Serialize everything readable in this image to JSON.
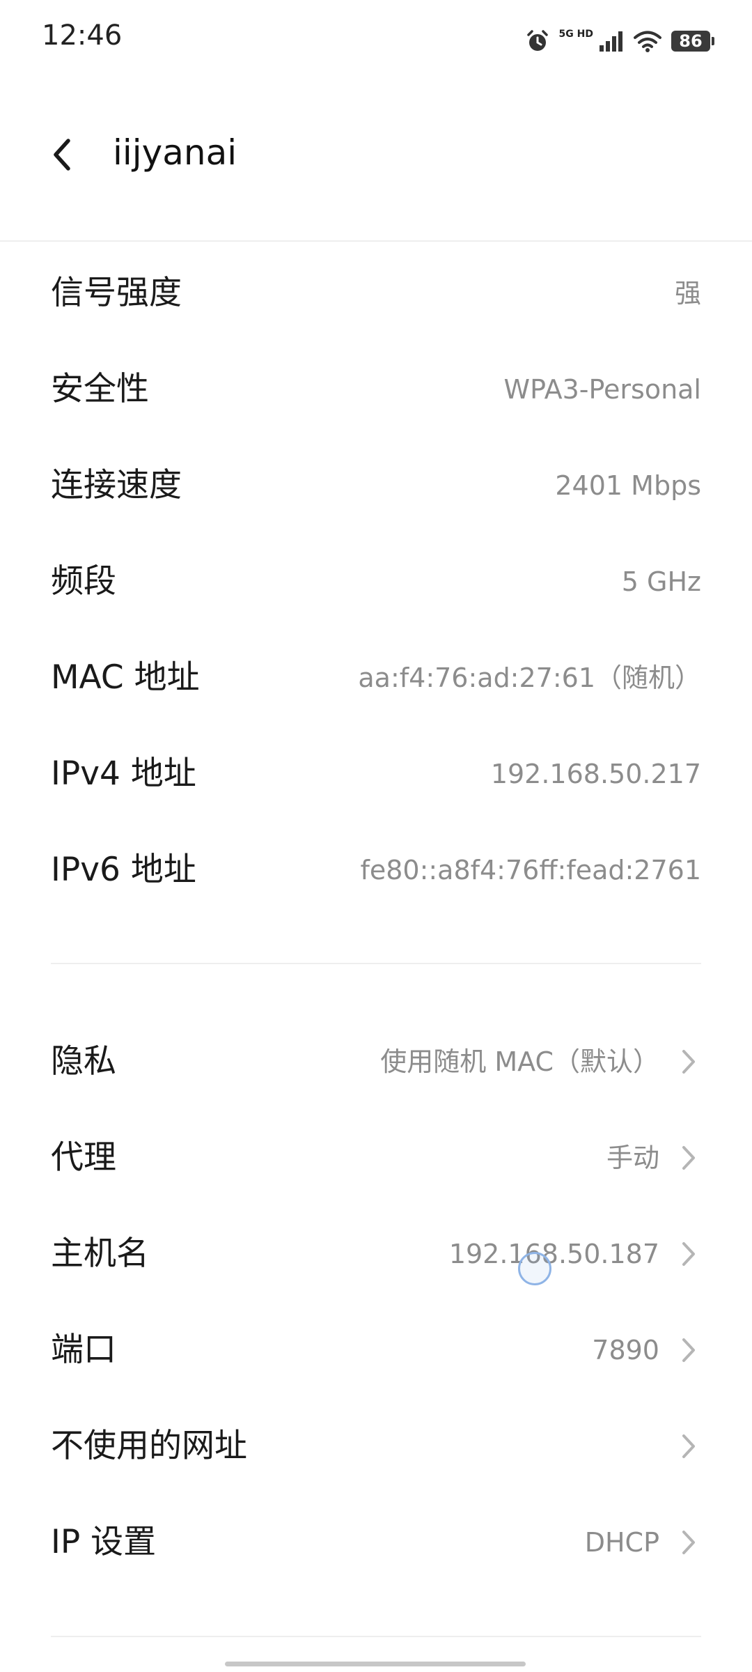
{
  "status_bar": {
    "time": "12:46",
    "network_label": "5G HD",
    "battery": "86",
    "icons": [
      "alarm-icon",
      "signal-icon",
      "wifi-icon",
      "battery-icon"
    ]
  },
  "header": {
    "title": "iijyanai",
    "back_icon": "chevron-left-icon"
  },
  "details": [
    {
      "label": "信号强度",
      "value": "强"
    },
    {
      "label": "安全性",
      "value": "WPA3-Personal"
    },
    {
      "label": "连接速度",
      "value": "2401 Mbps"
    },
    {
      "label": "频段",
      "value": "5 GHz"
    },
    {
      "label": "MAC 地址",
      "value": "aa:f4:76:ad:27:61（随机）"
    },
    {
      "label": "IPv4 地址",
      "value": "192.168.50.217"
    },
    {
      "label": "IPv6 地址",
      "value": "fe80::a8f4:76ff:fead:2761"
    }
  ],
  "settings": [
    {
      "label": "隐私",
      "value": "使用随机 MAC（默认）"
    },
    {
      "label": "代理",
      "value": "手动"
    },
    {
      "label": "主机名",
      "value": "192.168.50.187"
    },
    {
      "label": "端口",
      "value": "7890"
    },
    {
      "label": "不使用的网址",
      "value": ""
    },
    {
      "label": "IP 设置",
      "value": "DHCP"
    }
  ],
  "colors": {
    "background": "#ffffff",
    "primary_text": "#1a1a1a",
    "secondary_text": "#8c8c8c",
    "divider": "#eeeeee",
    "chevron": "#b5b5b5"
  }
}
